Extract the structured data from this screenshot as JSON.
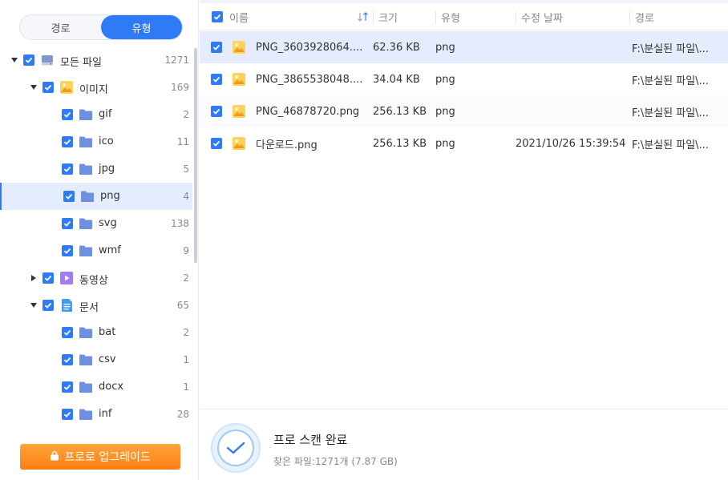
{
  "sidebar": {
    "tabs": [
      {
        "label": "경로",
        "active": false
      },
      {
        "label": "유형",
        "active": true
      }
    ],
    "tree": [
      {
        "label": "모든 파일",
        "count": "1271",
        "icon": "drive-icon",
        "expander": "down",
        "level": 0,
        "selected": false
      },
      {
        "label": "이미지",
        "count": "169",
        "icon": "image-category-icon",
        "expander": "down",
        "level": 1,
        "selected": false
      },
      {
        "label": "gif",
        "count": "2",
        "icon": "folder-icon",
        "expander": "none",
        "level": 2,
        "selected": false
      },
      {
        "label": "ico",
        "count": "11",
        "icon": "folder-icon",
        "expander": "none",
        "level": 2,
        "selected": false
      },
      {
        "label": "jpg",
        "count": "5",
        "icon": "folder-icon",
        "expander": "none",
        "level": 2,
        "selected": false
      },
      {
        "label": "png",
        "count": "4",
        "icon": "folder-icon",
        "expander": "none",
        "level": 2,
        "selected": true
      },
      {
        "label": "svg",
        "count": "138",
        "icon": "folder-icon",
        "expander": "none",
        "level": 2,
        "selected": false
      },
      {
        "label": "wmf",
        "count": "9",
        "icon": "folder-icon",
        "expander": "none",
        "level": 2,
        "selected": false
      },
      {
        "label": "동영상",
        "count": "2",
        "icon": "video-category-icon",
        "expander": "right",
        "level": 1,
        "selected": false
      },
      {
        "label": "문서",
        "count": "65",
        "icon": "document-category-icon",
        "expander": "down",
        "level": 1,
        "selected": false
      },
      {
        "label": "bat",
        "count": "2",
        "icon": "folder-icon",
        "expander": "none",
        "level": 2,
        "selected": false
      },
      {
        "label": "csv",
        "count": "1",
        "icon": "folder-icon",
        "expander": "none",
        "level": 2,
        "selected": false
      },
      {
        "label": "docx",
        "count": "1",
        "icon": "folder-icon",
        "expander": "none",
        "level": 2,
        "selected": false
      },
      {
        "label": "inf",
        "count": "28",
        "icon": "folder-icon",
        "expander": "none",
        "level": 2,
        "selected": false
      }
    ],
    "upgrade_label": "프로로 업그레이드"
  },
  "table": {
    "columns": {
      "name": "이름",
      "size": "크기",
      "type": "유형",
      "modified": "수정 날짜",
      "path": "경로"
    },
    "rows": [
      {
        "name": "PNG_3603928064....",
        "size": "62.36 KB",
        "type": "png",
        "modified": "",
        "path": "F:\\분실된 파일\\...",
        "selected": true
      },
      {
        "name": "PNG_3865538048....",
        "size": "34.04 KB",
        "type": "png",
        "modified": "",
        "path": "F:\\분실된 파일\\...",
        "selected": false
      },
      {
        "name": "PNG_46878720.png",
        "size": "256.13 KB",
        "type": "png",
        "modified": "",
        "path": "F:\\분실된 파일\\...",
        "selected": false
      },
      {
        "name": "다운로드.png",
        "size": "256.13 KB",
        "type": "png",
        "modified": "2021/10/26 15:39:54",
        "path": "F:\\분실된 파일\\...",
        "selected": false
      }
    ]
  },
  "status": {
    "title": "프로 스캔 완료",
    "subtitle": "찾은 파일:1271개 (7.87 GB)"
  },
  "colors": {
    "accent": "#2f7bf5",
    "selected_bg": "#e4ecfd",
    "upgrade_orange": "#ff8c1a",
    "folder": "#6f8fe0",
    "image_icon": "#f5b72f"
  }
}
